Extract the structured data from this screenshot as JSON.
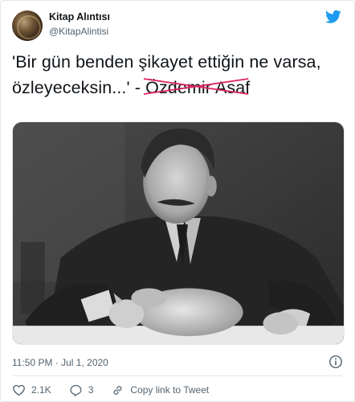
{
  "author": {
    "display_name": "Kitap Alıntısı",
    "handle": "@KitapAlintisi"
  },
  "tweet": {
    "text_main": "'Bir gün benden şikayet ettiğin ne varsa, özleyeceksin...' - ",
    "text_author": "Özdemir Asaf",
    "timestamp": "11:50 PM · Jul 1, 2020"
  },
  "actions": {
    "likes": "2.1K",
    "replies": "3",
    "copy_link_label": "Copy link to Tweet"
  },
  "icons": {
    "brand": "twitter-bird-icon",
    "info": "info-icon",
    "like": "heart-icon",
    "reply": "speech-bubble-icon",
    "copy": "link-icon"
  },
  "colors": {
    "twitter_blue": "#1d9bf0",
    "strike_red": "#e0245e",
    "secondary_text": "#536471"
  }
}
